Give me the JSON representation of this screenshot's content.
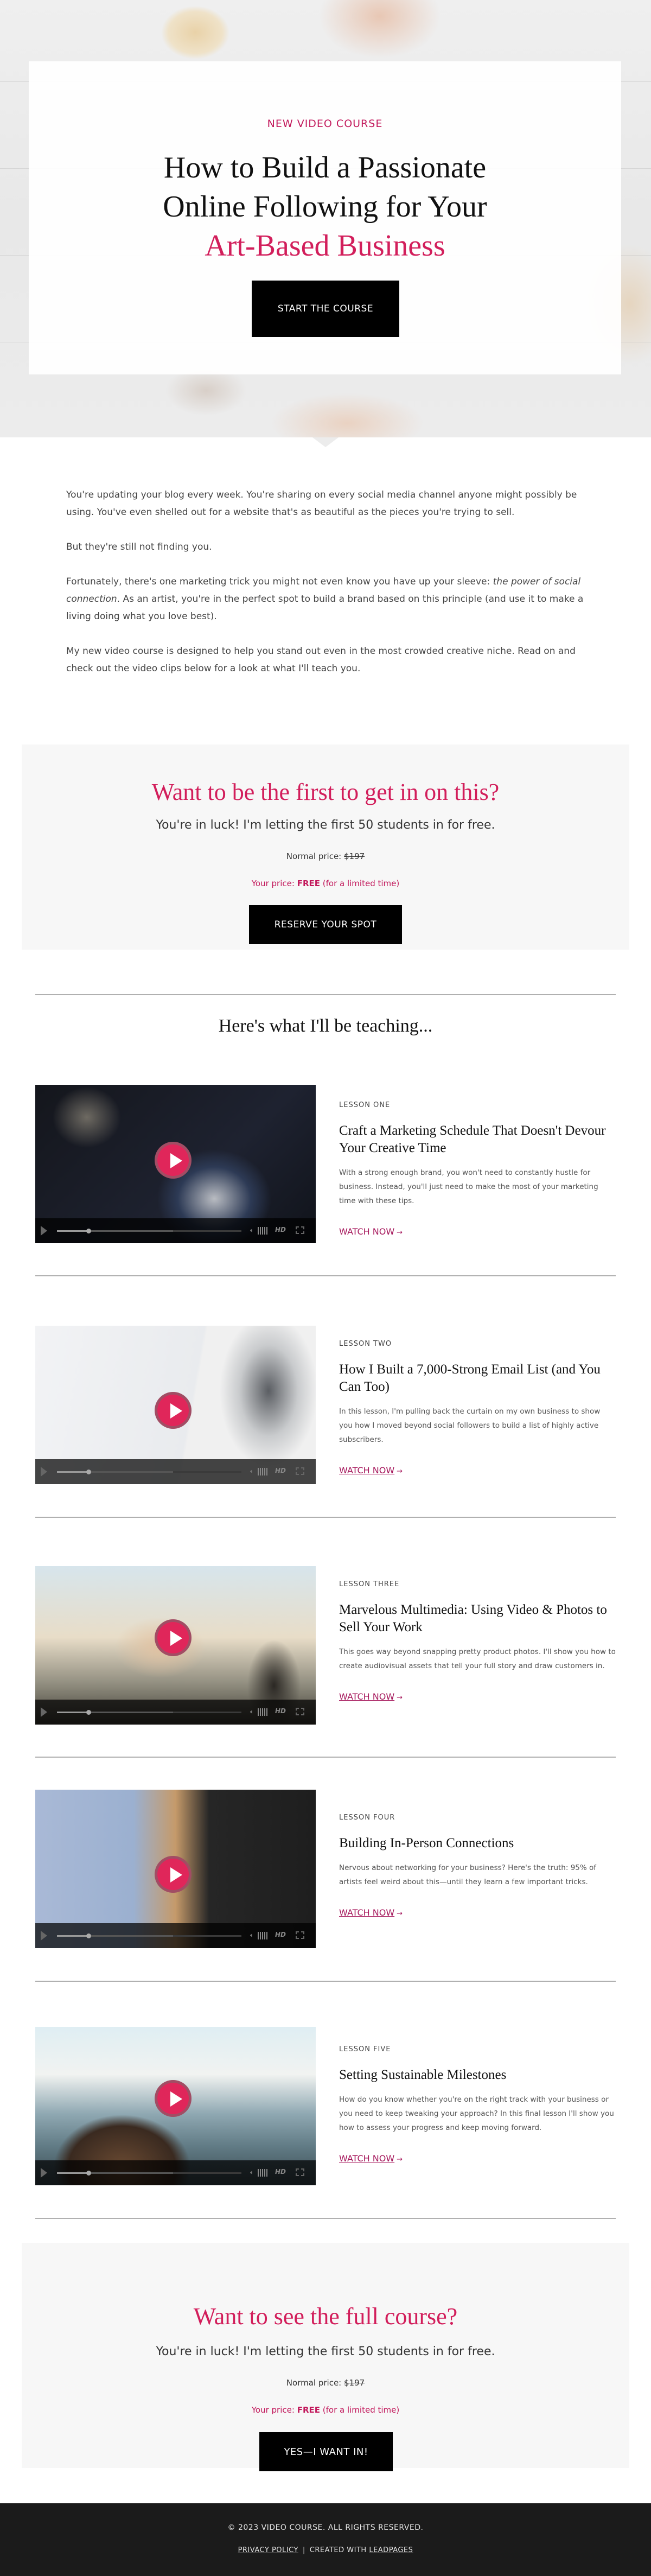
{
  "hero": {
    "eyebrow": "NEW VIDEO COURSE",
    "title_line1": "How to Build a Passionate",
    "title_line2": "Online Following for Your",
    "title_accent": "Art-Based Business",
    "cta_label": "START THE COURSE"
  },
  "intro": {
    "p1": "You're updating your blog every week. You're sharing on every social media channel anyone might possibly be using.  You've even shelled out for a website that's as beautiful as the pieces you're trying to sell.",
    "p2": "But they're still not finding you.",
    "p3_before": "Fortunately, there's one marketing trick you might not even know you have up your sleeve: ",
    "p3_em": "the power of social connection",
    "p3_after": ". As an artist, you're in the perfect spot to build a brand based on this principle (and use it to make a living doing what you love best).",
    "p4": "My new video course is designed to help you stand out even in the most crowded creative niche. Read on and check out the video clips below for a look at what I'll teach you."
  },
  "cta_top": {
    "heading": "Want to be the first to get in on this?",
    "lead": "You're in luck! I'm letting the first 50 students in for free.",
    "normal_label": "Normal price: ",
    "normal_price": "$197",
    "your_label": "Your price: ",
    "your_price": "FREE",
    "your_note": " (for a limited time)",
    "button": "RESERVE YOUR SPOT"
  },
  "lessons_heading": "Here's what I'll be teaching...",
  "lessons": [
    {
      "number": "LESSON ONE",
      "title": "Craft a Marketing Schedule That Doesn't Devour Your Creative Time",
      "description": "With a strong enough brand, you won't need to constantly hustle for business. Instead, you'll just need to make the most of your marketing time with these tips.",
      "link": "WATCH NOW",
      "arrow": "→",
      "thumbnail": "watch-in-box",
      "hd": "HD",
      "progress": 0.17,
      "buffered": 0.63
    },
    {
      "number": "LESSON TWO",
      "title": "How I Built a 7,000-Strong Email List (and You Can Too)",
      "description": "In this lesson, I'm pulling back the curtain on my own business to show you how I moved beyond social followers to build a list of highly active subscribers.",
      "link": "WATCH NOW",
      "arrow": "→",
      "thumbnail": "laptop-instagram",
      "hd": "HD",
      "progress": 0.17,
      "buffered": 0.63
    },
    {
      "number": "LESSON THREE",
      "title": "Marvelous Multimedia: Using Video & Photos to Sell Your Work",
      "description": "This goes way beyond snapping pretty product photos. I'll show you how to create audiovisual assets that tell your full story and draw customers in.",
      "link": "WATCH NOW",
      "arrow": "→",
      "thumbnail": "phone-recording-sunset",
      "hd": "HD",
      "progress": 0.17,
      "buffered": 0.63
    },
    {
      "number": "LESSON FOUR",
      "title": "Building In-Person Connections",
      "description": "Nervous about networking for your business? Here's the truth: 95% of artists feel weird about this—until they learn a few important tricks.",
      "link": "WATCH NOW",
      "arrow": "→",
      "thumbnail": "wine-gathering",
      "hd": "HD",
      "progress": 0.17,
      "buffered": 0.63
    },
    {
      "number": "LESSON FIVE",
      "title": "Setting Sustainable Milestones",
      "description": "How do you know whether you're on the right track with your business or you need to keep tweaking your approach? In this final lesson I'll show you how to assess your progress and keep moving forward.",
      "link": "WATCH NOW",
      "arrow": "→",
      "thumbnail": "hiker-mountain-peak",
      "hd": "HD",
      "progress": 0.17,
      "buffered": 0.63
    }
  ],
  "cta_bottom": {
    "heading": "Want to see the full course?",
    "lead": "You're in luck! I'm letting the first 50 students in for free.",
    "normal_label": "Normal price: ",
    "normal_price": "$197",
    "your_label": "Your price: ",
    "your_price": "FREE",
    "your_note": " (for a limited time)",
    "button": "YES—I WANT IN!"
  },
  "footer": {
    "copyright": "© 2023 VIDEO COURSE. ALL RIGHTS RESERVED.",
    "privacy": "PRIVACY POLICY",
    "separator": "|",
    "created_with": "CREATED WITH ",
    "leadpages": "LEADPAGES"
  },
  "colors": {
    "accent": "#d21e5b",
    "link": "#a5155a",
    "button_bg": "#000000",
    "cta_bg": "#f7f7f7",
    "footer_bg": "#1b1b1b",
    "play_button": "#e0265a"
  }
}
